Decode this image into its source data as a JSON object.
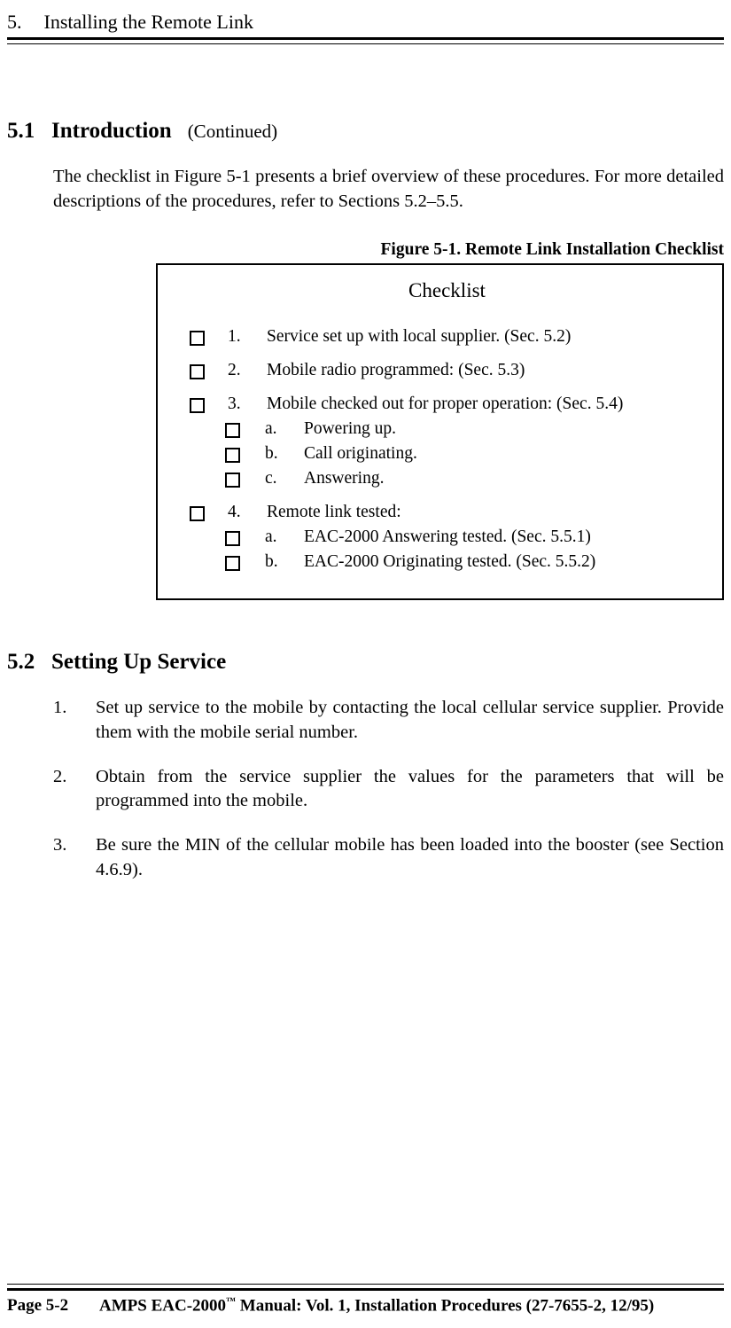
{
  "header": {
    "chapter_num": "5.",
    "chapter_title": "Installing the Remote Link"
  },
  "sec51": {
    "num": "5.1",
    "title": "Introduction",
    "cont": "(Continued)",
    "para": "The checklist in Figure 5-1 presents a brief overview of these procedures.  For more detailed descriptions of the procedures, refer to Sections 5.2–5.5."
  },
  "figure": {
    "caption": "Figure 5-1.  Remote Link Installation Checklist",
    "box_title": "Checklist",
    "items": {
      "i1_num": "1.",
      "i1_text": "Service set up with local supplier.  (Sec. 5.2)",
      "i2_num": "2.",
      "i2_text": "Mobile radio programmed:  (Sec. 5.3)",
      "i3_num": "3.",
      "i3_text": "Mobile checked out for proper operation:   (Sec. 5.4)",
      "i3a_num": "a.",
      "i3a_text": "Powering up.",
      "i3b_num": "b.",
      "i3b_text": "Call originating.",
      "i3c_num": "c.",
      "i3c_text": "Answering.",
      "i4_num": "4.",
      "i4_text": "Remote link tested:",
      "i4a_num": "a.",
      "i4a_text": "EAC-2000 Answering tested.  (Sec. 5.5.1)",
      "i4b_num": "b.",
      "i4b_text": "EAC-2000 Originating tested.  (Sec. 5.5.2)"
    }
  },
  "sec52": {
    "num": "5.2",
    "title": "Setting Up Service",
    "items": {
      "n1_num": "1.",
      "n1_text": "Set up service to the mobile by contacting the local cellular service supplier.  Provide them with the mobile serial number.",
      "n2_num": "2.",
      "n2_text": "Obtain from the service supplier the values for the parameters that will be programmed into the mobile.",
      "n3_num": "3.",
      "n3_text": "Be sure the MIN of the cellular mobile has been loaded into the booster (see Section 4.6.9)."
    }
  },
  "footer": {
    "page": "Page 5-2",
    "title_pre": "AMPS EAC-2000",
    "tm": "™",
    "title_post": " Manual:  Vol. 1, Installation Procedures (27-7655-2, 12/95)"
  }
}
